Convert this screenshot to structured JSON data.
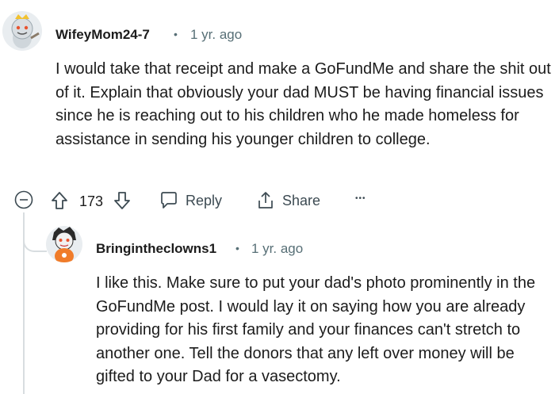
{
  "comment": {
    "username": "WifeyMom24-7",
    "separator": "•",
    "time": "1 yr. ago",
    "body": "I would take that receipt and make a GoFundMe and share the shit out of it. Explain that obviously your dad MUST be having financial issues since he is reaching out to his children who he made homeless for assistance in sending his younger children to college.",
    "votes": "173",
    "reply_label": "Reply",
    "share_label": "Share",
    "more_label": "•••"
  },
  "reply": {
    "username": "Bringintheclowns1",
    "separator": "•",
    "time": "1 yr. ago",
    "body": "I like this. Make sure to put your dad's photo prominently in the GoFundMe post. I would lay it on saying how you are already providing for his first family and your finances can't stretch to another one. Tell the donors that any left over money will be gifted to your Dad for a vasectomy."
  },
  "colors": {
    "text": "#1c1c1c",
    "meta": "#576f76",
    "icon": "#3c4a52",
    "thread_line": "#d8dde0"
  }
}
